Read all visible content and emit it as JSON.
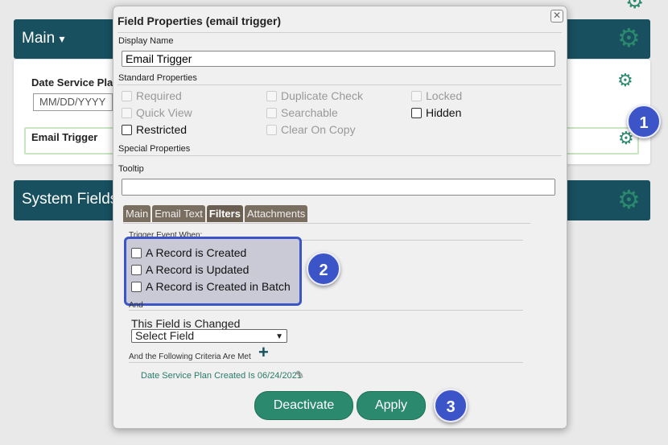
{
  "background": {
    "main_header": {
      "title": "Main",
      "caret": "▾"
    },
    "date_field": {
      "label": "Date Service Pla",
      "placeholder": "MM/DD/YYYY"
    },
    "email_field": {
      "label": "Email Trigger"
    },
    "system_header": {
      "title": "System Fields"
    },
    "icons": {
      "gear": "gear-icon"
    }
  },
  "modal": {
    "title": "Field Properties (email trigger)",
    "close_glyph": "✕",
    "display_name_label": "Display Name",
    "display_name_value": "Email Trigger",
    "standard_properties_label": "Standard Properties",
    "properties": {
      "required": "Required",
      "duplicate_check": "Duplicate Check",
      "locked": "Locked",
      "quick_view": "Quick View",
      "searchable": "Searchable",
      "hidden": "Hidden",
      "restricted": "Restricted",
      "clear_on_copy": "Clear On Copy"
    },
    "special_properties_label": "Special Properties",
    "tooltip_label": "Tooltip",
    "tooltip_value": "",
    "tabs": [
      "Main",
      "Email Text",
      "Filters",
      "Attachments"
    ],
    "active_tab": "Filters",
    "trigger_label": "Trigger Event When:",
    "triggers": [
      "A Record is Created",
      "A Record is Updated",
      "A Record is Created in Batch"
    ],
    "and_label": "And",
    "field_changed_label": "This Field is Changed",
    "select_value": "Select Field",
    "criteria_label": "And the Following Criteria Are Met",
    "criteria_item": "Date Service Plan Created Is 06/24/2021",
    "deactivate_label": "Deactivate",
    "apply_label": "Apply"
  },
  "badges": [
    "1",
    "2",
    "3"
  ],
  "colors": {
    "accent": "#2b8a6e",
    "header": "#185060",
    "badge": "#3b55c8"
  }
}
